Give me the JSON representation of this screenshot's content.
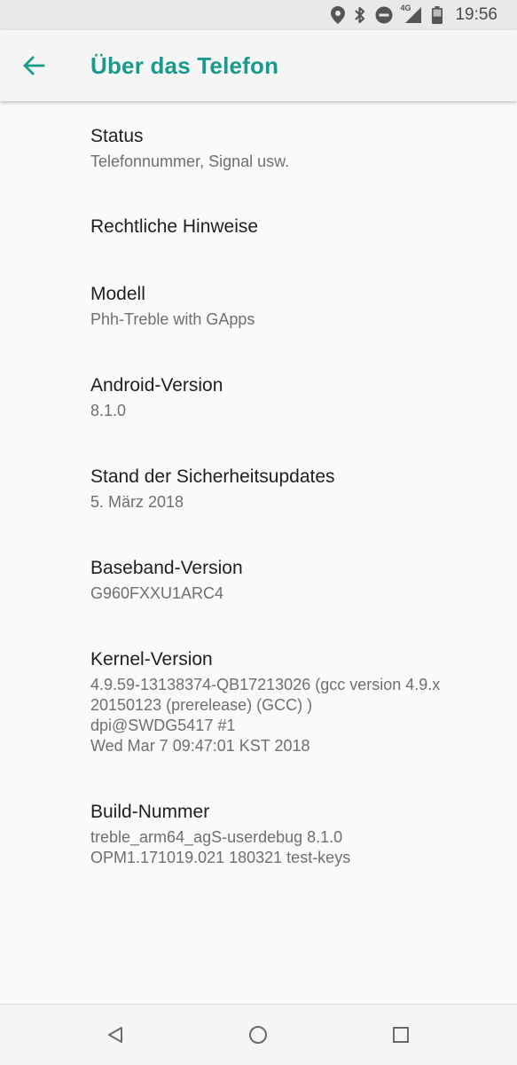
{
  "status_bar": {
    "time": "19:56",
    "network_label": "4G",
    "icons": [
      "location-icon",
      "bluetooth-icon",
      "do-not-disturb-icon",
      "signal-icon",
      "battery-icon"
    ]
  },
  "app_bar": {
    "title": "Über das Telefon",
    "back_icon": "arrow-back-icon",
    "accent_color": "#189a8c"
  },
  "items": [
    {
      "title": "Status",
      "summary": "Telefonnummer, Signal usw."
    },
    {
      "title": "Rechtliche Hinweise",
      "summary": ""
    },
    {
      "title": "Modell",
      "summary": "Phh-Treble with GApps"
    },
    {
      "title": "Android-Version",
      "summary": "8.1.0"
    },
    {
      "title": "Stand der Sicherheitsupdates",
      "summary": "5. März 2018"
    },
    {
      "title": "Baseband-Version",
      "summary": "G960FXXU1ARC4"
    },
    {
      "title": "Kernel-Version",
      "summary": "4.9.59-13138374-QB17213026 (gcc version 4.9.x\n20150123 (prerelease) (GCC) )\ndpi@SWDG5417 #1\nWed Mar 7 09:47:01 KST 2018"
    },
    {
      "title": "Build-Nummer",
      "summary": "treble_arm64_agS-userdebug 8.1.0\nOPM1.171019.021 180321 test-keys"
    }
  ],
  "nav_bar": {
    "icons": [
      "back-triangle-icon",
      "home-circle-icon",
      "recents-square-icon"
    ]
  }
}
